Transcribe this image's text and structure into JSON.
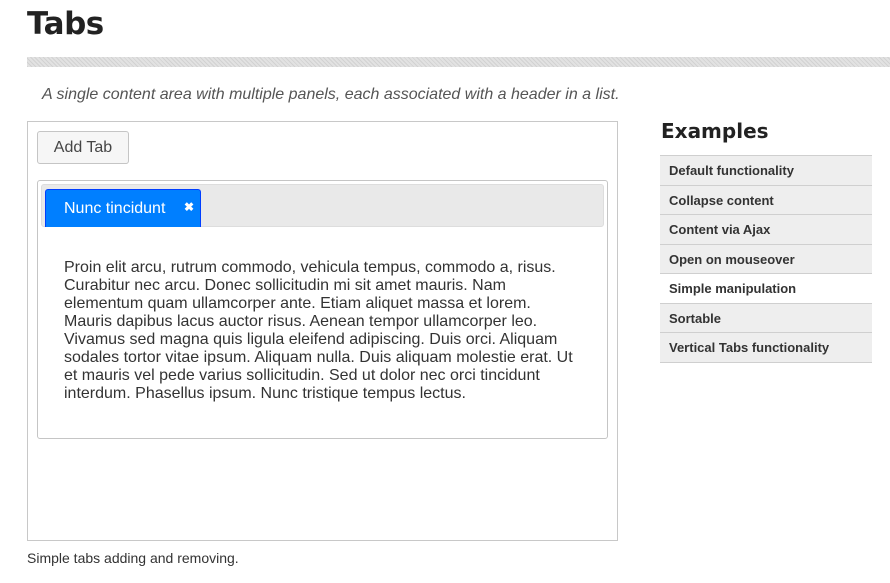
{
  "page": {
    "title": "Tabs",
    "description": "A single content area with multiple panels, each associated with a header in a list."
  },
  "demo": {
    "add_tab_label": "Add Tab",
    "tabs": [
      {
        "label": "Nunc tincidunt",
        "close_icon": "close-icon",
        "close_glyph": "✖",
        "active": true
      }
    ],
    "panel_text": "Proin elit arcu, rutrum commodo, vehicula tempus, commodo a, risus. Curabitur nec arcu. Donec sollicitudin mi sit amet mauris. Nam elementum quam ullamcorper ante. Etiam aliquet massa et lorem. Mauris dapibus lacus auctor risus. Aenean tempor ullamcorper leo. Vivamus sed magna quis ligula eleifend adipiscing. Duis orci. Aliquam sodales tortor vitae ipsum. Aliquam nulla. Duis aliquam molestie erat. Ut et mauris vel pede varius sollicitudin. Sed ut dolor nec orci tincidunt interdum. Phasellus ipsum. Nunc tristique tempus lectus.",
    "caption": "Simple tabs adding and removing."
  },
  "examples": {
    "heading": "Examples",
    "items": [
      {
        "label": "Default functionality",
        "active": false
      },
      {
        "label": "Collapse content",
        "active": false
      },
      {
        "label": "Content via Ajax",
        "active": false
      },
      {
        "label": "Open on mouseover",
        "active": false
      },
      {
        "label": "Simple manipulation",
        "active": true
      },
      {
        "label": "Sortable",
        "active": false
      },
      {
        "label": "Vertical Tabs functionality",
        "active": false
      }
    ]
  },
  "colors": {
    "active_tab": "#007fff",
    "active_tab_border": "#003eff",
    "sidebar_item_bg": "#eeeeee",
    "sidebar_item_active_bg": "#ffffff"
  }
}
